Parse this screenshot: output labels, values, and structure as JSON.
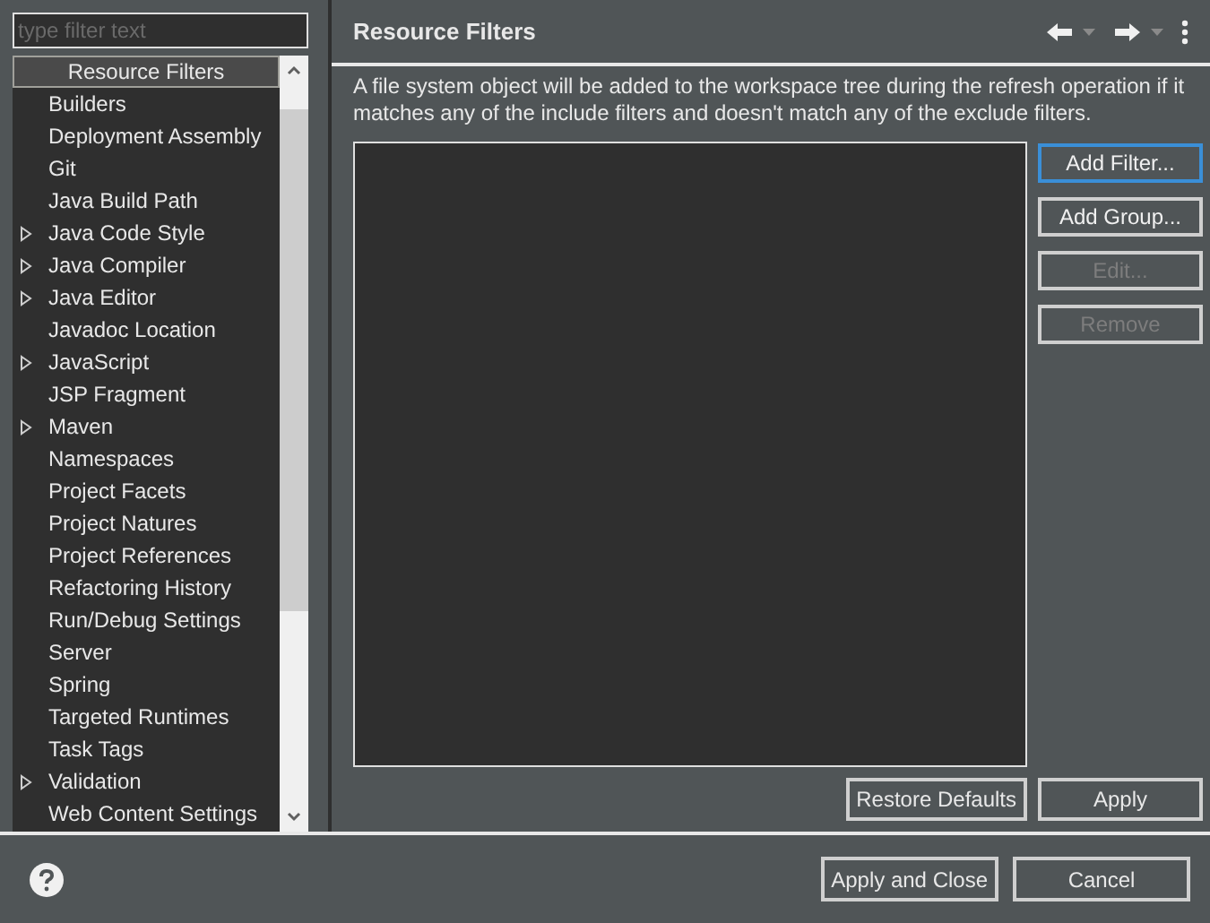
{
  "filter": {
    "placeholder": "type filter text"
  },
  "tree": [
    {
      "label": "Resource Filters",
      "selected": true,
      "expandable": false
    },
    {
      "label": "Builders",
      "selected": false,
      "expandable": false
    },
    {
      "label": "Deployment Assembly",
      "selected": false,
      "expandable": false
    },
    {
      "label": "Git",
      "selected": false,
      "expandable": false
    },
    {
      "label": "Java Build Path",
      "selected": false,
      "expandable": false
    },
    {
      "label": "Java Code Style",
      "selected": false,
      "expandable": true
    },
    {
      "label": "Java Compiler",
      "selected": false,
      "expandable": true
    },
    {
      "label": "Java Editor",
      "selected": false,
      "expandable": true
    },
    {
      "label": "Javadoc Location",
      "selected": false,
      "expandable": false
    },
    {
      "label": "JavaScript",
      "selected": false,
      "expandable": true
    },
    {
      "label": "JSP Fragment",
      "selected": false,
      "expandable": false
    },
    {
      "label": "Maven",
      "selected": false,
      "expandable": true
    },
    {
      "label": "Namespaces",
      "selected": false,
      "expandable": false
    },
    {
      "label": "Project Facets",
      "selected": false,
      "expandable": false
    },
    {
      "label": "Project Natures",
      "selected": false,
      "expandable": false
    },
    {
      "label": "Project References",
      "selected": false,
      "expandable": false
    },
    {
      "label": "Refactoring History",
      "selected": false,
      "expandable": false
    },
    {
      "label": "Run/Debug Settings",
      "selected": false,
      "expandable": false
    },
    {
      "label": "Server",
      "selected": false,
      "expandable": false
    },
    {
      "label": "Spring",
      "selected": false,
      "expandable": false
    },
    {
      "label": "Targeted Runtimes",
      "selected": false,
      "expandable": false
    },
    {
      "label": "Task Tags",
      "selected": false,
      "expandable": false
    },
    {
      "label": "Validation",
      "selected": false,
      "expandable": true
    },
    {
      "label": "Web Content Settings",
      "selected": false,
      "expandable": false
    }
  ],
  "page": {
    "title": "Resource Filters",
    "description": "A file system object will be added to the workspace tree during the refresh operation if it matches any of the include filters and doesn't match any of the exclude filters.",
    "side_buttons": [
      {
        "label": "Add Filter...",
        "disabled": false,
        "focused": true
      },
      {
        "label": "Add Group...",
        "disabled": false,
        "focused": false
      },
      {
        "label": "Edit...",
        "disabled": true,
        "focused": false
      },
      {
        "label": "Remove",
        "disabled": true,
        "focused": false
      }
    ],
    "page_buttons": [
      "Restore Defaults",
      "Apply"
    ]
  },
  "dialog_buttons": [
    "Apply and Close",
    "Cancel"
  ]
}
